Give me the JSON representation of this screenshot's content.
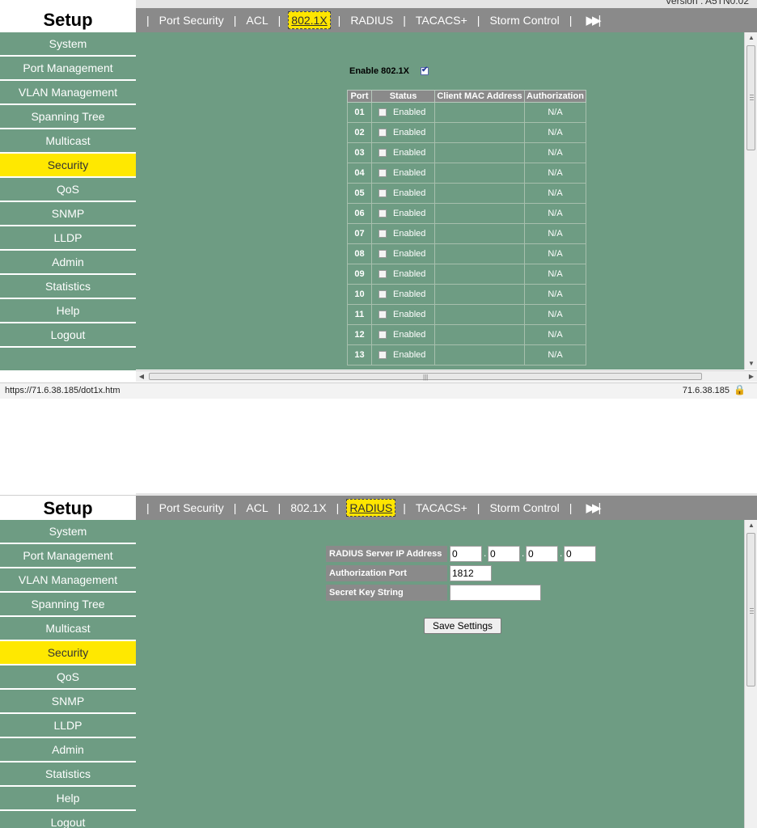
{
  "version_text": "Version : A5TN0.02",
  "brand": "Setup",
  "forward_icon": "fast-forward-icon",
  "sidebar": {
    "items": [
      "System",
      "Port Management",
      "VLAN Management",
      "Spanning Tree",
      "Multicast",
      "Security",
      "QoS",
      "SNMP",
      "LLDP",
      "Admin",
      "Statistics",
      "Help",
      "Logout"
    ],
    "active": "Security"
  },
  "tabs": {
    "items": [
      "Port Security",
      "ACL",
      "802.1X",
      "RADIUS",
      "TACACS+",
      "Storm Control"
    ]
  },
  "dot1x": {
    "active_tab": "802.1X",
    "enable_label": "Enable 802.1X",
    "enable_checked": true,
    "columns": [
      "Port",
      "Status",
      "Client MAC Address",
      "Authorization"
    ],
    "rows": [
      {
        "port": "01",
        "status": "Enabled",
        "mac": "",
        "auth": "N/A"
      },
      {
        "port": "02",
        "status": "Enabled",
        "mac": "",
        "auth": "N/A"
      },
      {
        "port": "03",
        "status": "Enabled",
        "mac": "",
        "auth": "N/A"
      },
      {
        "port": "04",
        "status": "Enabled",
        "mac": "",
        "auth": "N/A"
      },
      {
        "port": "05",
        "status": "Enabled",
        "mac": "",
        "auth": "N/A"
      },
      {
        "port": "06",
        "status": "Enabled",
        "mac": "",
        "auth": "N/A"
      },
      {
        "port": "07",
        "status": "Enabled",
        "mac": "",
        "auth": "N/A"
      },
      {
        "port": "08",
        "status": "Enabled",
        "mac": "",
        "auth": "N/A"
      },
      {
        "port": "09",
        "status": "Enabled",
        "mac": "",
        "auth": "N/A"
      },
      {
        "port": "10",
        "status": "Enabled",
        "mac": "",
        "auth": "N/A"
      },
      {
        "port": "11",
        "status": "Enabled",
        "mac": "",
        "auth": "N/A"
      },
      {
        "port": "12",
        "status": "Enabled",
        "mac": "",
        "auth": "N/A"
      },
      {
        "port": "13",
        "status": "Enabled",
        "mac": "",
        "auth": "N/A"
      }
    ]
  },
  "statusbar": {
    "url": "https://71.6.38.185/dot1x.htm",
    "ip": "71.6.38.185"
  },
  "radius": {
    "active_tab": "RADIUS",
    "server_ip_label": "RADIUS Server IP Address",
    "ip_octets": [
      "0",
      "0",
      "0",
      "0"
    ],
    "auth_port_label": "Authorization Port",
    "auth_port_value": "1812",
    "secret_label": "Secret Key String",
    "secret_value": "",
    "save_label": "Save Settings"
  },
  "colors": {
    "content_bg": "#6e9c83",
    "tabbar_bg": "#8a8a8a",
    "active_highlight": "#ffe800"
  }
}
